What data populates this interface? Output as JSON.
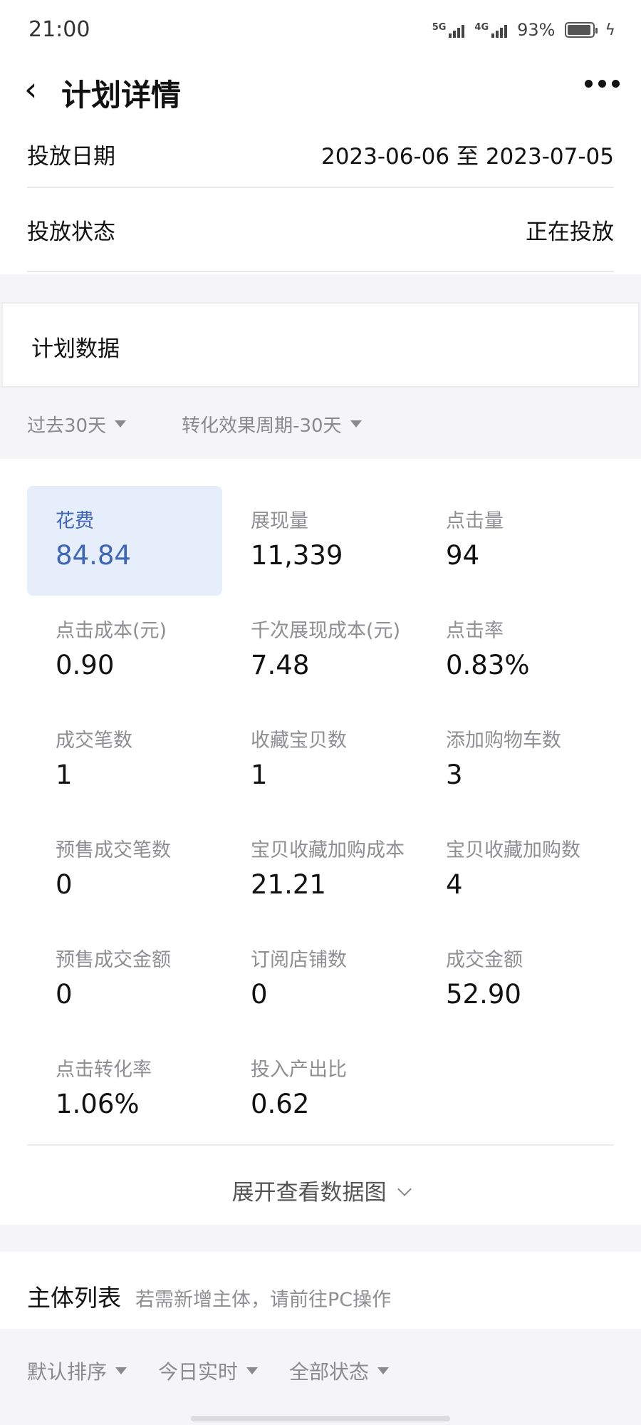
{
  "status_bar": {
    "time": "21:00",
    "signal_1": "5G",
    "signal_2": "4G",
    "battery": "93%",
    "battery_level": 0.93
  },
  "navbar": {
    "title": "计划详情"
  },
  "info": {
    "date_label": "投放日期",
    "date_value": "2023-06-06 至 2023-07-05",
    "status_label": "投放状态",
    "status_value": "正在投放"
  },
  "section_title": "计划数据",
  "filters": {
    "period": "过去30天",
    "conversion": "转化效果周期-30天"
  },
  "metrics": [
    {
      "label": "花费",
      "value": "84.84"
    },
    {
      "label": "展现量",
      "value": "11,339"
    },
    {
      "label": "点击量",
      "value": "94"
    },
    {
      "label": "点击成本(元)",
      "value": "0.90"
    },
    {
      "label": "千次展现成本(元)",
      "value": "7.48"
    },
    {
      "label": "点击率",
      "value": "0.83%"
    },
    {
      "label": "成交笔数",
      "value": "1"
    },
    {
      "label": "收藏宝贝数",
      "value": "1"
    },
    {
      "label": "添加购物车数",
      "value": "3"
    },
    {
      "label": "预售成交笔数",
      "value": "0"
    },
    {
      "label": "宝贝收藏加购成本",
      "value": "21.21"
    },
    {
      "label": "宝贝收藏加购数",
      "value": "4"
    },
    {
      "label": "预售成交金额",
      "value": "0"
    },
    {
      "label": "订阅店铺数",
      "value": "0"
    },
    {
      "label": "成交金额",
      "value": "52.90"
    },
    {
      "label": "点击转化率",
      "value": "1.06%"
    },
    {
      "label": "投入产出比",
      "value": "0.62"
    }
  ],
  "expand_label": "展开查看数据图",
  "entity": {
    "title": "主体列表",
    "hint": "若需新增主体，请前往PC操作"
  },
  "filters2": {
    "sort": "默认排序",
    "time": "今日实时",
    "status": "全部状态"
  },
  "colors": {
    "accent": "#3d66b8",
    "active_bg": "#e7eefb"
  }
}
